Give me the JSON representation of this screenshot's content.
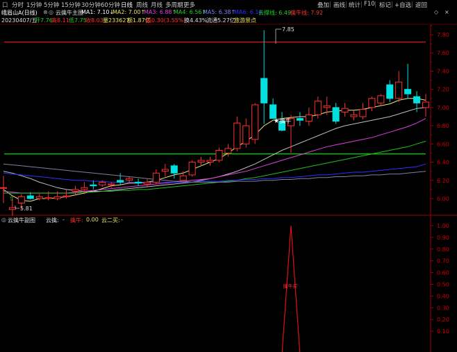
{
  "toolbar": {
    "items": [
      "分时",
      "1分钟",
      "5分钟",
      "15分钟",
      "30分钟",
      "60分钟",
      "日线",
      "周线",
      "月线",
      "多周期",
      "更多"
    ],
    "active_index": 6,
    "right_items": [
      "叠加",
      "画线",
      "统计",
      "F10",
      "标记",
      "+自选",
      "返回"
    ],
    "settings_glyph": "口"
  },
  "info1": {
    "name": "峨眉山A(日线)",
    "indicator": "云擒牛主图",
    "ma1": "MA1: 7.10↓",
    "ma2": "MA2: 7.00↑",
    "ma3": "MA3: 6.88↑",
    "ma4": "MA4: 6.56↑",
    "ma5": "MA5: 6.38↑",
    "ma6": "MA6: 6.16",
    "cloud_support": "云撑线: 6.49",
    "pressure": "擒牛线: 7.92"
  },
  "info2": {
    "date": "20230407/五",
    "open": "开7.76",
    "high": "高8.11",
    "low": "低7.75",
    "close": "收8.03",
    "volume": "量233627",
    "amount": "额1.87亿",
    "change": "幅0.30(3.55%)",
    "turnover": "换4.43%",
    "float": "流通5.27亿",
    "sector": "旅游景点"
  },
  "price_axis": [
    "7.80",
    "7.60",
    "7.40",
    "7.20",
    "7.00",
    "6.80",
    "6.60",
    "6.40",
    "6.20",
    "6.00"
  ],
  "lower_axis": [
    "1.00",
    "0.90",
    "0.80",
    "0.70",
    "0.60",
    "0.50",
    "0.40",
    "0.30",
    "0.20",
    "0.10"
  ],
  "annotations": {
    "high_label": "7.85",
    "low_label": "5.81",
    "signal_label": "擒牛"
  },
  "lower_panel": {
    "title": "云擒牛副图",
    "param1": "云擒:",
    "param1_value": "-",
    "param2": "擒牛:",
    "param2_value": "0.00",
    "param3": "云二买:",
    "param3_value": "-",
    "spike_label": "擒牛买"
  },
  "colors": {
    "up": "#ff3030",
    "down": "#00e0e0",
    "redline": "#e01010",
    "greenline": "#00e000",
    "ma_yellow": "#e8e890",
    "ma_magenta": "#e040e0",
    "ma_green": "#20c020",
    "ma_blue": "#3030ff",
    "ma_white": "#c0c0c0"
  },
  "chart_data": {
    "type": "candlestick",
    "ylim": [
      5.8,
      7.9
    ],
    "horizontal_lines": [
      7.72,
      6.49
    ],
    "candles": [
      {
        "o": 6.12,
        "h": 6.25,
        "l": 5.95,
        "c": 6.12
      },
      {
        "o": 5.88,
        "h": 6.0,
        "l": 5.81,
        "c": 5.9
      },
      {
        "o": 5.95,
        "h": 6.05,
        "l": 5.88,
        "c": 6.02
      },
      {
        "o": 6.03,
        "h": 6.07,
        "l": 5.99,
        "c": 6.0
      },
      {
        "o": 6.0,
        "h": 6.05,
        "l": 5.98,
        "c": 6.02
      },
      {
        "o": 6.0,
        "h": 6.08,
        "l": 5.98,
        "c": 6.01
      },
      {
        "o": 6.0,
        "h": 6.08,
        "l": 5.98,
        "c": 6.02
      },
      {
        "o": 6.02,
        "h": 6.1,
        "l": 6.0,
        "c": 6.03
      },
      {
        "o": 6.08,
        "h": 6.14,
        "l": 6.04,
        "c": 6.1
      },
      {
        "o": 6.1,
        "h": 6.18,
        "l": 6.05,
        "c": 6.12
      },
      {
        "o": 6.15,
        "h": 6.2,
        "l": 6.1,
        "c": 6.14
      },
      {
        "o": 6.15,
        "h": 6.2,
        "l": 6.13,
        "c": 6.18
      },
      {
        "o": 6.15,
        "h": 6.18,
        "l": 6.12,
        "c": 6.16
      },
      {
        "o": 6.2,
        "h": 6.28,
        "l": 6.15,
        "c": 6.18
      },
      {
        "o": 6.2,
        "h": 6.24,
        "l": 6.16,
        "c": 6.22
      },
      {
        "o": 6.18,
        "h": 6.22,
        "l": 6.14,
        "c": 6.17
      },
      {
        "o": 6.16,
        "h": 6.22,
        "l": 6.13,
        "c": 6.18
      },
      {
        "o": 6.18,
        "h": 6.32,
        "l": 6.16,
        "c": 6.28
      },
      {
        "o": 6.3,
        "h": 6.38,
        "l": 6.24,
        "c": 6.32
      },
      {
        "o": 6.36,
        "h": 6.38,
        "l": 6.22,
        "c": 6.28
      },
      {
        "o": 6.2,
        "h": 6.3,
        "l": 6.18,
        "c": 6.25
      },
      {
        "o": 6.26,
        "h": 6.42,
        "l": 6.24,
        "c": 6.4
      },
      {
        "o": 6.4,
        "h": 6.46,
        "l": 6.36,
        "c": 6.42
      },
      {
        "o": 6.4,
        "h": 6.46,
        "l": 6.36,
        "c": 6.42
      },
      {
        "o": 6.42,
        "h": 6.56,
        "l": 6.4,
        "c": 6.53
      },
      {
        "o": 6.5,
        "h": 6.6,
        "l": 6.46,
        "c": 6.55
      },
      {
        "o": 6.55,
        "h": 6.9,
        "l": 6.52,
        "c": 6.83
      },
      {
        "o": 6.6,
        "h": 6.88,
        "l": 6.56,
        "c": 6.8
      },
      {
        "o": 6.65,
        "h": 7.05,
        "l": 6.6,
        "c": 7.03
      },
      {
        "o": 7.32,
        "h": 7.85,
        "l": 6.82,
        "c": 7.05
      },
      {
        "o": 7.03,
        "h": 7.1,
        "l": 6.88,
        "c": 6.88
      },
      {
        "o": 6.85,
        "h": 6.95,
        "l": 6.74,
        "c": 6.75
      },
      {
        "o": 6.8,
        "h": 6.92,
        "l": 6.5,
        "c": 6.88
      },
      {
        "o": 6.88,
        "h": 6.95,
        "l": 6.8,
        "c": 6.86
      },
      {
        "o": 6.85,
        "h": 7.0,
        "l": 6.8,
        "c": 6.92
      },
      {
        "o": 6.92,
        "h": 7.12,
        "l": 6.88,
        "c": 7.07
      },
      {
        "o": 7.0,
        "h": 7.12,
        "l": 6.92,
        "c": 7.02
      },
      {
        "o": 7.0,
        "h": 7.05,
        "l": 6.82,
        "c": 6.85
      },
      {
        "o": 6.95,
        "h": 7.05,
        "l": 6.9,
        "c": 6.99
      },
      {
        "o": 6.9,
        "h": 6.97,
        "l": 6.86,
        "c": 6.92
      },
      {
        "o": 6.9,
        "h": 7.05,
        "l": 6.87,
        "c": 6.98
      },
      {
        "o": 7.0,
        "h": 7.12,
        "l": 6.96,
        "c": 7.1
      },
      {
        "o": 7.05,
        "h": 7.15,
        "l": 7.02,
        "c": 7.13
      },
      {
        "o": 7.25,
        "h": 7.3,
        "l": 7.06,
        "c": 7.1
      },
      {
        "o": 7.1,
        "h": 7.4,
        "l": 7.06,
        "c": 7.28
      },
      {
        "o": 7.2,
        "h": 7.48,
        "l": 7.1,
        "c": 7.15
      },
      {
        "o": 7.12,
        "h": 7.18,
        "l": 6.95,
        "c": 7.05
      },
      {
        "o": 7.0,
        "h": 7.15,
        "l": 6.9,
        "c": 7.06
      }
    ],
    "ma_lines": [
      {
        "name": "MA1",
        "color": "#e8e890",
        "values": [
          6.1,
          6.03,
          5.98,
          5.97,
          6.0,
          6.0,
          6.01,
          6.02,
          6.04,
          6.06,
          6.08,
          6.11,
          6.14,
          6.15,
          6.17,
          6.17,
          6.18,
          6.2,
          6.23,
          6.26,
          6.28,
          6.32,
          6.36,
          6.4,
          6.44,
          6.5,
          6.57,
          6.63,
          6.7,
          6.8,
          6.86,
          6.88,
          6.89,
          6.9,
          6.9,
          6.92,
          6.95,
          6.96,
          6.97,
          6.97,
          6.98,
          7.0,
          7.02,
          7.04,
          7.08,
          7.1,
          7.1,
          7.08
        ]
      },
      {
        "name": "MA2",
        "color": "#c0c0c0",
        "values": [
          6.3,
          6.28,
          6.25,
          6.22,
          6.18,
          6.15,
          6.12,
          6.1,
          6.09,
          6.08,
          6.08,
          6.08,
          6.09,
          6.1,
          6.11,
          6.12,
          6.13,
          6.14,
          6.15,
          6.16,
          6.17,
          6.18,
          6.2,
          6.22,
          6.24,
          6.27,
          6.3,
          6.34,
          6.38,
          6.43,
          6.48,
          6.53,
          6.57,
          6.61,
          6.65,
          6.69,
          6.73,
          6.77,
          6.8,
          6.82,
          6.84,
          6.86,
          6.88,
          6.9,
          6.93,
          6.96,
          6.99,
          7.0
        ]
      },
      {
        "name": "MA3",
        "color": "#e040e0",
        "values": [
          6.08,
          6.07,
          6.06,
          6.06,
          6.06,
          6.06,
          6.06,
          6.06,
          6.07,
          6.08,
          6.09,
          6.1,
          6.11,
          6.12,
          6.13,
          6.14,
          6.15,
          6.16,
          6.17,
          6.18,
          6.19,
          6.2,
          6.21,
          6.22,
          6.24,
          6.26,
          6.28,
          6.3,
          6.33,
          6.36,
          6.39,
          6.42,
          6.45,
          6.48,
          6.51,
          6.54,
          6.57,
          6.59,
          6.61,
          6.63,
          6.65,
          6.67,
          6.7,
          6.73,
          6.76,
          6.79,
          6.83,
          6.88
        ]
      },
      {
        "name": "MA4",
        "color": "#20c020",
        "values": [
          6.06,
          6.06,
          6.06,
          6.06,
          6.06,
          6.06,
          6.06,
          6.06,
          6.06,
          6.07,
          6.07,
          6.08,
          6.08,
          6.09,
          6.09,
          6.1,
          6.1,
          6.11,
          6.12,
          6.13,
          6.14,
          6.15,
          6.16,
          6.17,
          6.18,
          6.19,
          6.2,
          6.22,
          6.23,
          6.25,
          6.27,
          6.29,
          6.31,
          6.33,
          6.35,
          6.37,
          6.39,
          6.41,
          6.43,
          6.45,
          6.47,
          6.49,
          6.51,
          6.53,
          6.55,
          6.57,
          6.6,
          6.63
        ]
      },
      {
        "name": "MA5",
        "color": "#3030ff",
        "values": [
          6.28,
          6.27,
          6.26,
          6.25,
          6.24,
          6.23,
          6.22,
          6.21,
          6.2,
          6.2,
          6.19,
          6.19,
          6.18,
          6.18,
          6.18,
          6.18,
          6.18,
          6.18,
          6.18,
          6.18,
          6.18,
          6.18,
          6.19,
          6.19,
          6.19,
          6.2,
          6.2,
          6.21,
          6.21,
          6.22,
          6.22,
          6.23,
          6.23,
          6.24,
          6.25,
          6.26,
          6.26,
          6.27,
          6.28,
          6.29,
          6.29,
          6.3,
          6.31,
          6.32,
          6.33,
          6.34,
          6.35,
          6.38
        ]
      },
      {
        "name": "MA6",
        "color": "#8080a0",
        "values": [
          6.38,
          6.37,
          6.36,
          6.35,
          6.34,
          6.33,
          6.32,
          6.31,
          6.3,
          6.29,
          6.28,
          6.27,
          6.26,
          6.25,
          6.24,
          6.23,
          6.22,
          6.21,
          6.2,
          6.19,
          6.19,
          6.18,
          6.18,
          6.18,
          6.18,
          6.18,
          6.19,
          6.19,
          6.19,
          6.2,
          6.2,
          6.21,
          6.21,
          6.22,
          6.22,
          6.23,
          6.23,
          6.24,
          6.24,
          6.25,
          6.25,
          6.26,
          6.26,
          6.27,
          6.27,
          6.28,
          6.29,
          6.3
        ]
      }
    ],
    "lower": {
      "ylim": [
        0,
        1.05
      ],
      "spike_index": 32,
      "spike_value": 1.0
    }
  }
}
